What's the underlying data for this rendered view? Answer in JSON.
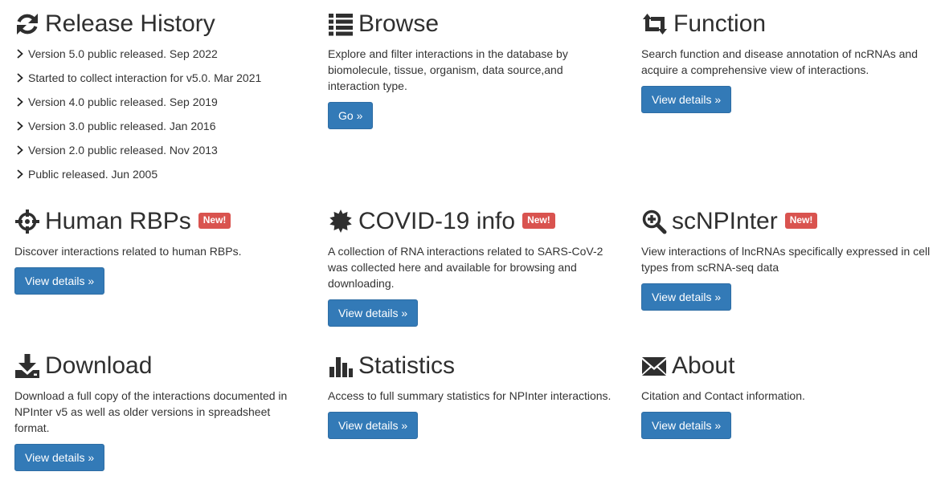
{
  "release_history": {
    "title": "Release History",
    "icon": "refresh-icon",
    "items": [
      "Version 5.0 public released. Sep 2022",
      "Started to collect interaction for v5.0. Mar 2021",
      "Version 4.0 public released. Sep 2019",
      "Version 3.0 public released. Jan 2016",
      "Version 2.0 public released. Nov 2013",
      "Public released. Jun 2005"
    ]
  },
  "browse": {
    "title": "Browse",
    "icon": "list-icon",
    "description": "Explore and filter interactions in the database by biomolecule, tissue, organism, data source,and interaction type.",
    "button": "Go »"
  },
  "function": {
    "title": "Function",
    "icon": "retweet-icon",
    "description": "Search function and disease annotation of ncRNAs and acquire a comprehensive view of interactions.",
    "button": "View details »"
  },
  "human_rbps": {
    "title": "Human RBPs",
    "icon": "crosshair-icon",
    "badge": "New!",
    "description": "Discover interactions related to human RBPs.",
    "button": "View details »"
  },
  "covid": {
    "title": "COVID-19 info",
    "icon": "virus-icon",
    "badge": "New!",
    "description": "A collection of RNA interactions related to SARS-CoV-2 was collected here and available for browsing and downloading.",
    "button": "View details »"
  },
  "scnpinter": {
    "title": "scNPInter",
    "icon": "zoom-in-icon",
    "badge": "New!",
    "description": "View interactions of lncRNAs specifically expressed in cell types from scRNA-seq data",
    "button": "View details »"
  },
  "download": {
    "title": "Download",
    "icon": "download-icon",
    "description": "Download a full copy of the interactions documented in NPInter v5 as well as older versions in spreadsheet format.",
    "button": "View details »"
  },
  "statistics": {
    "title": "Statistics",
    "icon": "stats-icon",
    "description": "Access to full summary statistics for NPInter interactions.",
    "button": "View details »"
  },
  "about": {
    "title": "About",
    "icon": "envelope-icon",
    "description": "Citation and Contact information.",
    "button": "View details »"
  },
  "colors": {
    "button": "#337ab7",
    "badge": "#d9534f",
    "text": "#333333"
  }
}
